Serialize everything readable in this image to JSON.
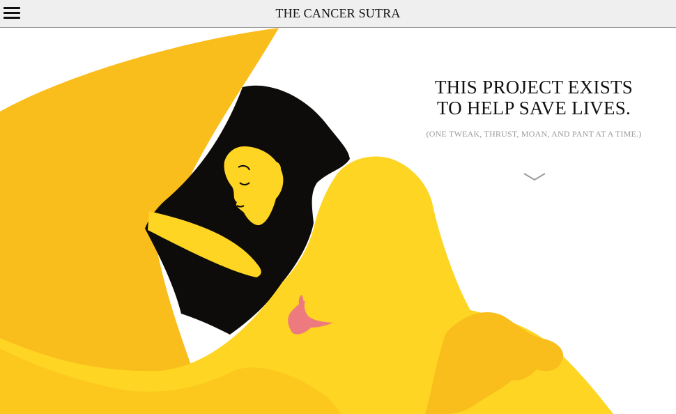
{
  "header": {
    "menu_icon": "hamburger-menu-icon",
    "title": "THE CANCER SUTRA"
  },
  "hero": {
    "headline_line1": "THIS PROJECT EXISTS",
    "headline_line2": "TO HELP SAVE LIVES.",
    "subheadline": "(ONE TWEAK, THRUST, MOAN, AND PANT AT A TIME.)",
    "scroll_icon": "chevron-down-icon"
  },
  "colors": {
    "background": "#ffffff",
    "topbar": "#efefef",
    "yellow_light": "#fed522",
    "yellow_dark": "#f9bd1c",
    "black": "#0e0c0a",
    "bird_pink": "#ec7a7e",
    "text": "#111111",
    "subtext": "#9a9a9a"
  }
}
